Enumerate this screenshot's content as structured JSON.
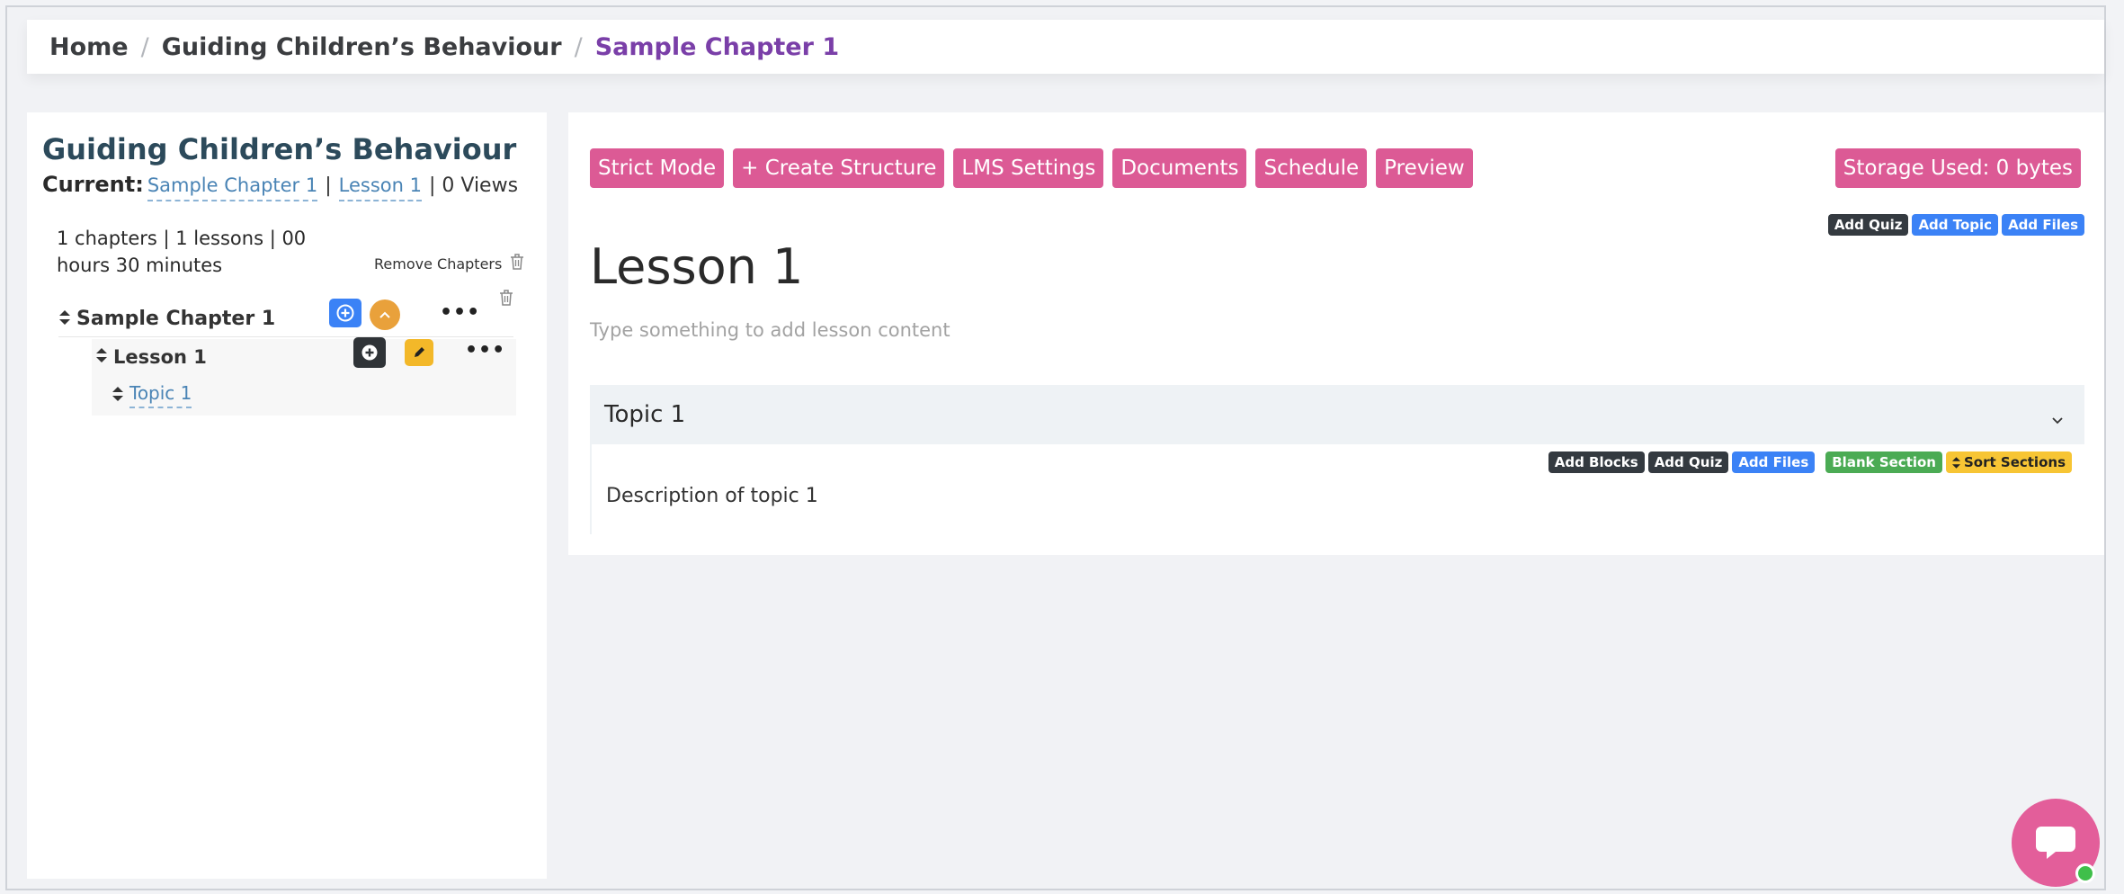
{
  "breadcrumb": {
    "home": "Home",
    "course": "Guiding Children’s Behaviour",
    "current": "Sample Chapter 1",
    "separator": "/"
  },
  "sidebar": {
    "course_title": "Guiding Children’s Behaviour",
    "current_label": "Current:",
    "current_chapter": "Sample Chapter 1",
    "current_lesson": "Lesson 1",
    "pipe": "|",
    "views": "| 0 Views",
    "summary": "1 chapters | 1 lessons | 00 hours 30 minutes",
    "remove_chapters": "Remove Chapters",
    "tree": {
      "chapter": "Sample Chapter 1",
      "lesson": "Lesson 1",
      "topic": "Topic 1"
    },
    "dots": "•••"
  },
  "toolbar": {
    "strict_mode": "Strict Mode",
    "create_structure": "+ Create Structure",
    "lms_settings": "LMS Settings",
    "documents": "Documents",
    "schedule": "Schedule",
    "preview": "Preview",
    "storage": "Storage Used: 0 bytes"
  },
  "lesson_tags": {
    "add_quiz": "Add Quiz",
    "add_topic": "Add Topic",
    "add_files": "Add Files"
  },
  "lesson": {
    "title": "Lesson 1",
    "placeholder": "Type something to add lesson content"
  },
  "topic": {
    "title": "Topic 1",
    "description": "Description of topic 1",
    "tags": {
      "add_blocks": "Add Blocks",
      "add_quiz": "Add Quiz",
      "add_files": "Add Files",
      "blank_section": "Blank Section",
      "sort_sections": "Sort Sections"
    }
  },
  "colors": {
    "accent_pink": "#dc5a95",
    "breadcrumb_active": "#7a3fa8",
    "title_color": "#2c4a5b",
    "link_blue": "#4a84b5"
  }
}
